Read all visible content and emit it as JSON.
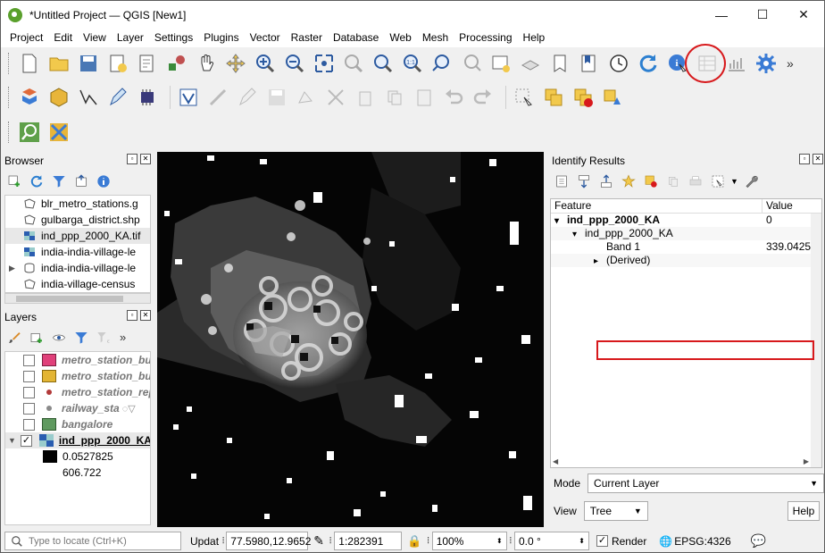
{
  "window": {
    "title": "*Untitled Project — QGIS [New1]",
    "minimize": "—",
    "maximize": "☐",
    "close": "✕"
  },
  "menu": [
    "Project",
    "Edit",
    "View",
    "Layer",
    "Settings",
    "Plugins",
    "Vector",
    "Raster",
    "Database",
    "Web",
    "Mesh",
    "Processing",
    "Help"
  ],
  "browser": {
    "title": "Browser",
    "items": [
      {
        "label": "blr_metro_stations.g",
        "icon": "polygon-layer-icon"
      },
      {
        "label": "gulbarga_district.shp",
        "icon": "polygon-layer-icon"
      },
      {
        "label": "ind_ppp_2000_KA.tif",
        "icon": "raster-layer-icon"
      },
      {
        "label": "india-india-village-le",
        "icon": "raster-layer-icon"
      },
      {
        "label": "india-india-village-le",
        "icon": "database-icon"
      },
      {
        "label": "india-village-census",
        "icon": "polygon-layer-icon"
      }
    ]
  },
  "layers": {
    "title": "Layers",
    "items": [
      {
        "label": "metro_station_buf",
        "color": "#e0407a",
        "kind": "polygon"
      },
      {
        "label": "metro_station_buf",
        "color": "#e3b534",
        "kind": "polygon"
      },
      {
        "label": "metro_station_rep",
        "color": "#b23a3a",
        "kind": "point"
      },
      {
        "label": "railway_sta",
        "color": "#8a8a8a",
        "kind": "point"
      },
      {
        "label": "bangalore",
        "color": "#5f9a5f",
        "kind": "polygon"
      },
      {
        "label": "ind_ppp_2000_KA",
        "color": "",
        "kind": "raster",
        "checked": true
      }
    ],
    "legend": [
      {
        "color": "#000000",
        "value": "0.0527825"
      },
      {
        "color": "#ffffff",
        "value": "606.722"
      }
    ]
  },
  "identify": {
    "title": "Identify Results",
    "col_feature": "Feature",
    "col_value": "Value",
    "rows": [
      {
        "label": "ind_ppp_2000_KA",
        "value": "0",
        "bold": true,
        "arrow": "▾",
        "indent": 0
      },
      {
        "label": "ind_ppp_2000_KA",
        "value": "",
        "bold": false,
        "arrow": "▾",
        "indent": 1
      },
      {
        "label": "Band 1",
        "value": "339.0425",
        "bold": false,
        "arrow": "",
        "indent": 2
      },
      {
        "label": "(Derived)",
        "value": "",
        "bold": false,
        "arrow": "▸",
        "indent": 2
      }
    ],
    "mode_label": "Mode",
    "mode_value": "Current Layer",
    "view_label": "View",
    "view_value": "Tree",
    "help": "Help"
  },
  "status": {
    "locator_placeholder": "Type to locate (Ctrl+K)",
    "update_label": "Updat",
    "coordinate": "77.5980,12.9652",
    "scale": "1:282391",
    "magnifier": "100%",
    "rotation": "0.0 °",
    "render": "Render",
    "crs": "EPSG:4326"
  }
}
